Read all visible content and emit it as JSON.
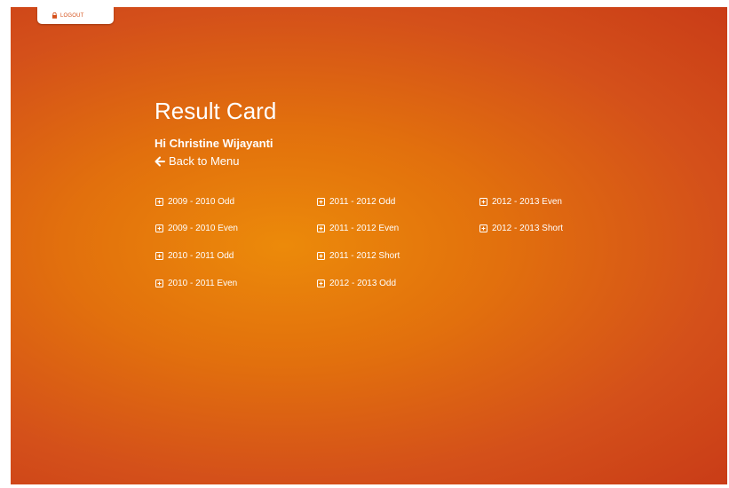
{
  "logout": {
    "label": "LOGOUT",
    "icon": "lock-icon"
  },
  "page": {
    "title": "Result Card",
    "greeting": "Hi Christine Wijayanti",
    "back_label": "Back to Menu",
    "back_icon": "arrow-left-icon"
  },
  "colors": {
    "accent": "#e2700d",
    "edge": "#c93c17",
    "text": "#ffffff"
  },
  "semesters": [
    {
      "label": "2009 - 2010 Odd",
      "icon": "plus-square-icon"
    },
    {
      "label": "2009 - 2010 Even",
      "icon": "plus-square-icon"
    },
    {
      "label": "2010 - 2011 Odd",
      "icon": "plus-square-icon"
    },
    {
      "label": "2010 - 2011 Even",
      "icon": "plus-square-icon"
    },
    {
      "label": "2011 - 2012 Odd",
      "icon": "plus-square-icon"
    },
    {
      "label": "2011 - 2012 Even",
      "icon": "plus-square-icon"
    },
    {
      "label": "2011 - 2012 Short",
      "icon": "plus-square-icon"
    },
    {
      "label": "2012 - 2013 Odd",
      "icon": "plus-square-icon"
    },
    {
      "label": "2012 - 2013 Even",
      "icon": "plus-square-icon"
    },
    {
      "label": "2012 - 2013 Short",
      "icon": "plus-square-icon"
    }
  ]
}
